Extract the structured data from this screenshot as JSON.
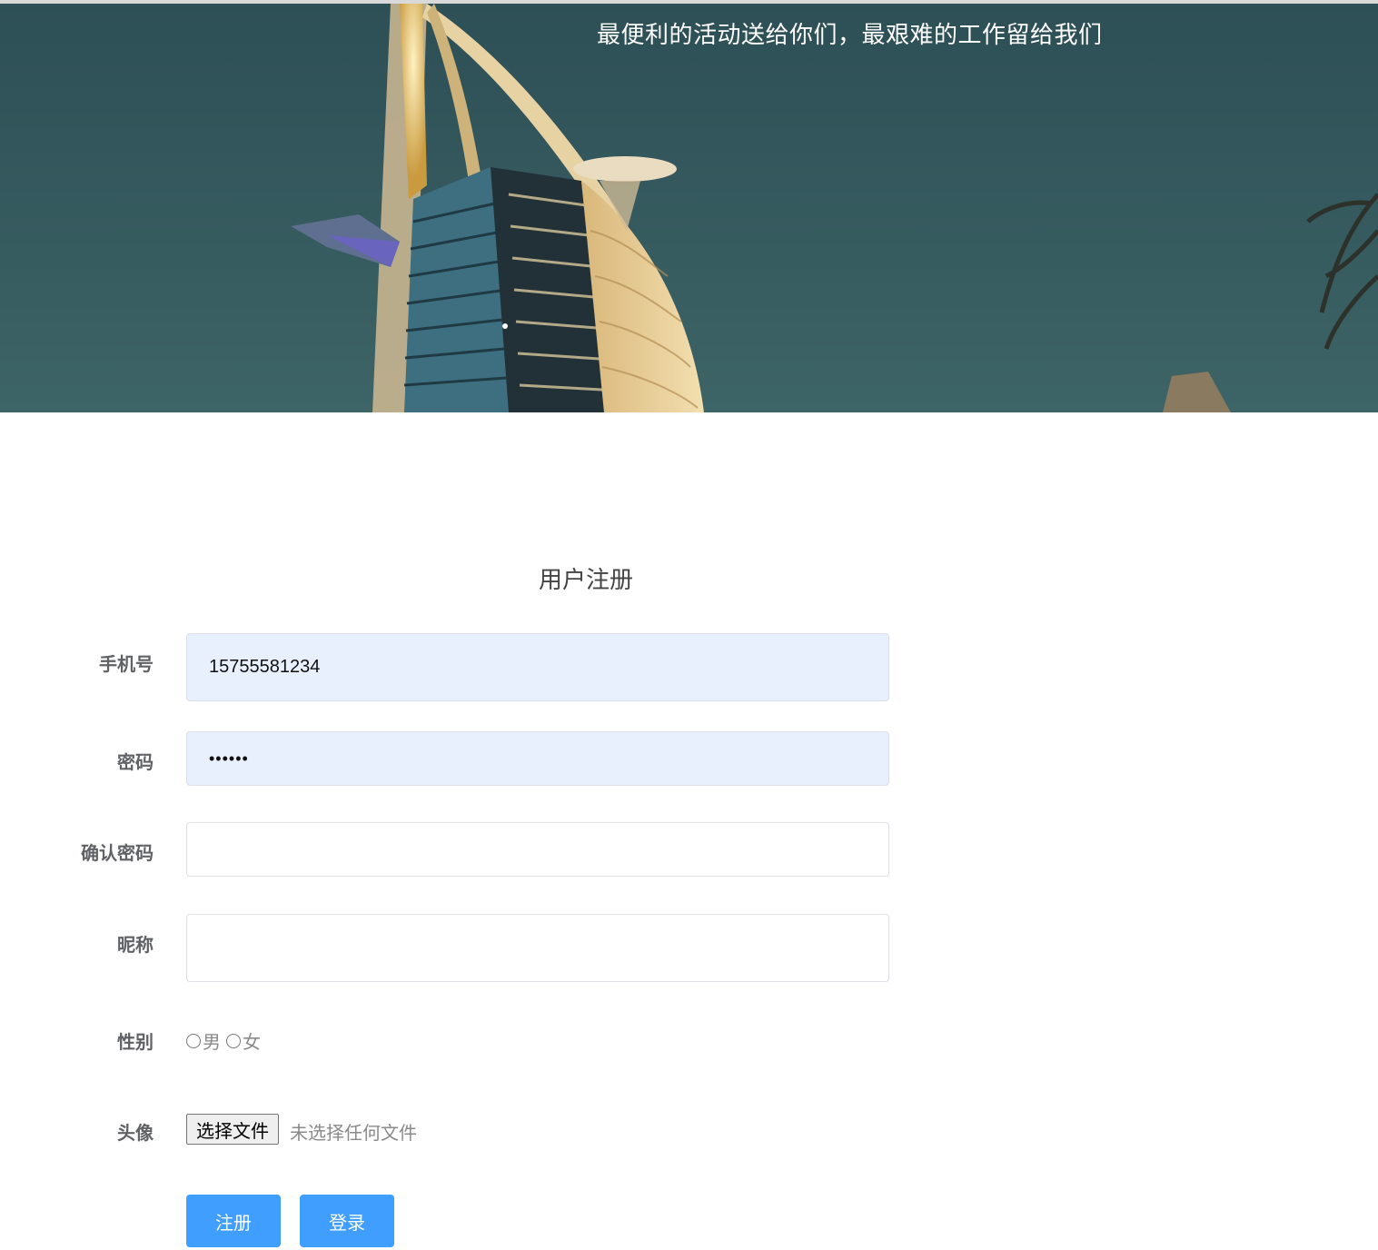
{
  "banner": {
    "slogan": "最便利的活动送给你们，最艰难的工作留给我们"
  },
  "form": {
    "title": "用户注册",
    "phone": {
      "label": "手机号",
      "value": "15755581234"
    },
    "password": {
      "label": "密码",
      "value": "••••••"
    },
    "confirm_password": {
      "label": "确认密码",
      "value": ""
    },
    "nickname": {
      "label": "昵称",
      "value": ""
    },
    "gender": {
      "label": "性别",
      "options": [
        "男",
        "女"
      ]
    },
    "avatar": {
      "label": "头像",
      "button": "选择文件",
      "status": "未选择任何文件"
    },
    "buttons": {
      "register": "注册",
      "login": "登录"
    }
  },
  "colors": {
    "primary_button": "#409eff",
    "autofill_background": "#e8f0fe",
    "label_text": "#606266"
  }
}
